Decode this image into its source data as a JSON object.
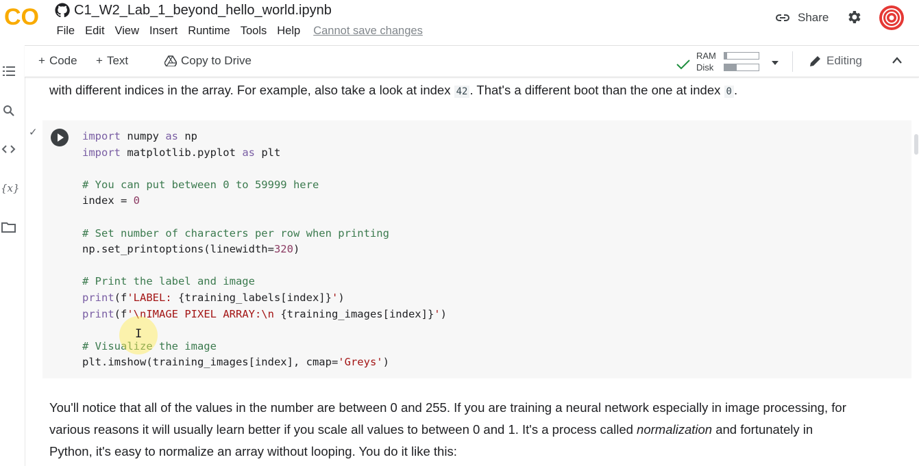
{
  "header": {
    "logo_text": "CO",
    "title": "C1_W2_Lab_1_beyond_hello_world.ipynb",
    "menu": [
      "File",
      "Edit",
      "View",
      "Insert",
      "Runtime",
      "Tools",
      "Help"
    ],
    "cannot_save": "Cannot save changes",
    "share_label": "Share"
  },
  "toolbar": {
    "code_label": "Code",
    "text_label": "Text",
    "copy_label": "Copy to Drive",
    "ram_label": "RAM",
    "disk_label": "Disk",
    "ram_fraction": 0.08,
    "disk_fraction": 0.35,
    "editing_label": "Editing"
  },
  "notebook": {
    "text_above": {
      "before": "with different indices in the array. For example, also take a look at index ",
      "code1": "42",
      "middle": ". That's a different boot than the one at index ",
      "code2": "0",
      "after": "."
    },
    "code_lines": [
      [
        {
          "t": "import",
          "c": "kw"
        },
        {
          "t": " numpy "
        },
        {
          "t": "as",
          "c": "kw"
        },
        {
          "t": " np"
        }
      ],
      [
        {
          "t": "import",
          "c": "kw"
        },
        {
          "t": " matplotlib.pyplot "
        },
        {
          "t": "as",
          "c": "kw"
        },
        {
          "t": " plt"
        }
      ],
      [],
      [
        {
          "t": "# You can put between 0 to 59999 here",
          "c": "cm"
        }
      ],
      [
        {
          "t": "index = "
        },
        {
          "t": "0",
          "c": "num"
        }
      ],
      [],
      [
        {
          "t": "# Set number of characters per row when printing",
          "c": "cm"
        }
      ],
      [
        {
          "t": "np.set_printoptions(linewidth="
        },
        {
          "t": "320",
          "c": "num"
        },
        {
          "t": ")"
        }
      ],
      [],
      [
        {
          "t": "# Print the label and image",
          "c": "cm"
        }
      ],
      [
        {
          "t": "print",
          "c": "kw"
        },
        {
          "t": "(f"
        },
        {
          "t": "'LABEL: ",
          "c": "st"
        },
        {
          "t": "{training_labels[index]}"
        },
        {
          "t": "'",
          "c": "st"
        },
        {
          "t": ")"
        }
      ],
      [
        {
          "t": "print",
          "c": "kw"
        },
        {
          "t": "(f"
        },
        {
          "t": "'\\nIMAGE PIXEL ARRAY:\\n ",
          "c": "st"
        },
        {
          "t": "{training_images[index]}"
        },
        {
          "t": "'",
          "c": "st"
        },
        {
          "t": ")"
        }
      ],
      [],
      [
        {
          "t": "# Visualize the image",
          "c": "cm"
        }
      ],
      [
        {
          "t": "plt.imshow(training_images[index], cmap="
        },
        {
          "t": "'Greys'",
          "c": "st"
        },
        {
          "t": ")"
        }
      ]
    ],
    "text_below": {
      "line1": "You'll notice that all of the values in the number are between 0 and 255. If you are training a neural network especially in image processing, for",
      "line2_before": "various reasons it will usually learn better if you scale all values to between 0 and 1. It's a process called ",
      "line2_em": "normalization",
      "line2_after": " and fortunately in",
      "line3": "Python, it's easy to normalize an array without looping. You do it like this:"
    }
  },
  "colors": {
    "logo_orange": "#f9ab00",
    "logo_dark_orange": "#e8710a",
    "avatar_red": "#e53935"
  }
}
